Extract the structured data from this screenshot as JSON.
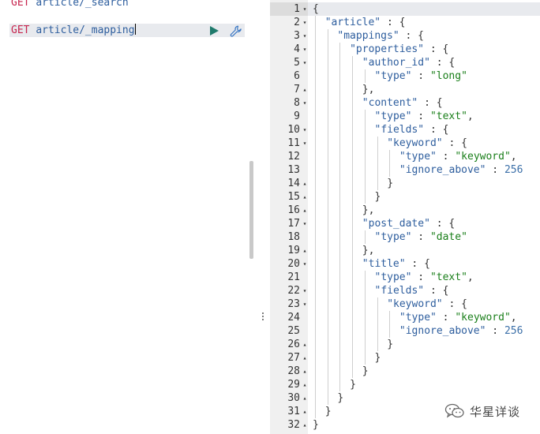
{
  "request_editor": {
    "lines": [
      {
        "method": "GET",
        "path": "article/_search"
      },
      {
        "method": "GET",
        "path": "article/_mapping"
      }
    ]
  },
  "response": {
    "line_numbers": [
      "1",
      "2",
      "3",
      "4",
      "5",
      "6",
      "7",
      "8",
      "9",
      "10",
      "11",
      "12",
      "13",
      "14",
      "15",
      "16",
      "17",
      "18",
      "19",
      "20",
      "21",
      "22",
      "23",
      "24",
      "25",
      "26",
      "27",
      "28",
      "29",
      "30",
      "31",
      "32"
    ],
    "fold_markers": [
      "down",
      "down",
      "down",
      "down",
      "down",
      "",
      "up",
      "down",
      "",
      "down",
      "down",
      "",
      "",
      "up",
      "up",
      "up",
      "down",
      "",
      "up",
      "down",
      "",
      "down",
      "down",
      "",
      "",
      "up",
      "up",
      "up",
      "up",
      "up",
      "up",
      "up"
    ],
    "lines": [
      {
        "indent": 0,
        "tokens": [
          [
            "p",
            "{"
          ]
        ]
      },
      {
        "indent": 1,
        "tokens": [
          [
            "k",
            "\"article\""
          ],
          [
            "p",
            " : {"
          ]
        ]
      },
      {
        "indent": 2,
        "tokens": [
          [
            "k",
            "\"mappings\""
          ],
          [
            "p",
            " : {"
          ]
        ]
      },
      {
        "indent": 3,
        "tokens": [
          [
            "k",
            "\"properties\""
          ],
          [
            "p",
            " : {"
          ]
        ]
      },
      {
        "indent": 4,
        "tokens": [
          [
            "k",
            "\"author_id\""
          ],
          [
            "p",
            " : {"
          ]
        ]
      },
      {
        "indent": 5,
        "tokens": [
          [
            "k",
            "\"type\""
          ],
          [
            "p",
            " : "
          ],
          [
            "s",
            "\"long\""
          ]
        ]
      },
      {
        "indent": 4,
        "tokens": [
          [
            "p",
            "},"
          ]
        ]
      },
      {
        "indent": 4,
        "tokens": [
          [
            "k",
            "\"content\""
          ],
          [
            "p",
            " : {"
          ]
        ]
      },
      {
        "indent": 5,
        "tokens": [
          [
            "k",
            "\"type\""
          ],
          [
            "p",
            " : "
          ],
          [
            "s",
            "\"text\""
          ],
          [
            "p",
            ","
          ]
        ]
      },
      {
        "indent": 5,
        "tokens": [
          [
            "k",
            "\"fields\""
          ],
          [
            "p",
            " : {"
          ]
        ]
      },
      {
        "indent": 6,
        "tokens": [
          [
            "k",
            "\"keyword\""
          ],
          [
            "p",
            " : {"
          ]
        ]
      },
      {
        "indent": 7,
        "tokens": [
          [
            "k",
            "\"type\""
          ],
          [
            "p",
            " : "
          ],
          [
            "s",
            "\"keyword\""
          ],
          [
            "p",
            ","
          ]
        ]
      },
      {
        "indent": 7,
        "tokens": [
          [
            "k",
            "\"ignore_above\""
          ],
          [
            "p",
            " : "
          ],
          [
            "n",
            "256"
          ]
        ]
      },
      {
        "indent": 6,
        "tokens": [
          [
            "p",
            "}"
          ]
        ]
      },
      {
        "indent": 5,
        "tokens": [
          [
            "p",
            "}"
          ]
        ]
      },
      {
        "indent": 4,
        "tokens": [
          [
            "p",
            "},"
          ]
        ]
      },
      {
        "indent": 4,
        "tokens": [
          [
            "k",
            "\"post_date\""
          ],
          [
            "p",
            " : {"
          ]
        ]
      },
      {
        "indent": 5,
        "tokens": [
          [
            "k",
            "\"type\""
          ],
          [
            "p",
            " : "
          ],
          [
            "s",
            "\"date\""
          ]
        ]
      },
      {
        "indent": 4,
        "tokens": [
          [
            "p",
            "},"
          ]
        ]
      },
      {
        "indent": 4,
        "tokens": [
          [
            "k",
            "\"title\""
          ],
          [
            "p",
            " : {"
          ]
        ]
      },
      {
        "indent": 5,
        "tokens": [
          [
            "k",
            "\"type\""
          ],
          [
            "p",
            " : "
          ],
          [
            "s",
            "\"text\""
          ],
          [
            "p",
            ","
          ]
        ]
      },
      {
        "indent": 5,
        "tokens": [
          [
            "k",
            "\"fields\""
          ],
          [
            "p",
            " : {"
          ]
        ]
      },
      {
        "indent": 6,
        "tokens": [
          [
            "k",
            "\"keyword\""
          ],
          [
            "p",
            " : {"
          ]
        ]
      },
      {
        "indent": 7,
        "tokens": [
          [
            "k",
            "\"type\""
          ],
          [
            "p",
            " : "
          ],
          [
            "s",
            "\"keyword\""
          ],
          [
            "p",
            ","
          ]
        ]
      },
      {
        "indent": 7,
        "tokens": [
          [
            "k",
            "\"ignore_above\""
          ],
          [
            "p",
            " : "
          ],
          [
            "n",
            "256"
          ]
        ]
      },
      {
        "indent": 6,
        "tokens": [
          [
            "p",
            "}"
          ]
        ]
      },
      {
        "indent": 5,
        "tokens": [
          [
            "p",
            "}"
          ]
        ]
      },
      {
        "indent": 4,
        "tokens": [
          [
            "p",
            "}"
          ]
        ]
      },
      {
        "indent": 3,
        "tokens": [
          [
            "p",
            "}"
          ]
        ]
      },
      {
        "indent": 2,
        "tokens": [
          [
            "p",
            "}"
          ]
        ]
      },
      {
        "indent": 1,
        "tokens": [
          [
            "p",
            "}"
          ]
        ]
      },
      {
        "indent": 0,
        "tokens": [
          [
            "p",
            "}"
          ]
        ]
      }
    ]
  },
  "watermark": {
    "text": "华星详谈",
    "icon": "wechat-icon"
  },
  "icons": {
    "run": "play-icon",
    "settings": "wrench-icon",
    "splitter": "vertical-ellipsis-icon"
  },
  "colors": {
    "method": "#c7254e",
    "path": "#2e5e9e",
    "key": "#2e5e9e",
    "string": "#1a7f1a",
    "number": "#3b6fa8",
    "run": "#1f7a6c"
  }
}
